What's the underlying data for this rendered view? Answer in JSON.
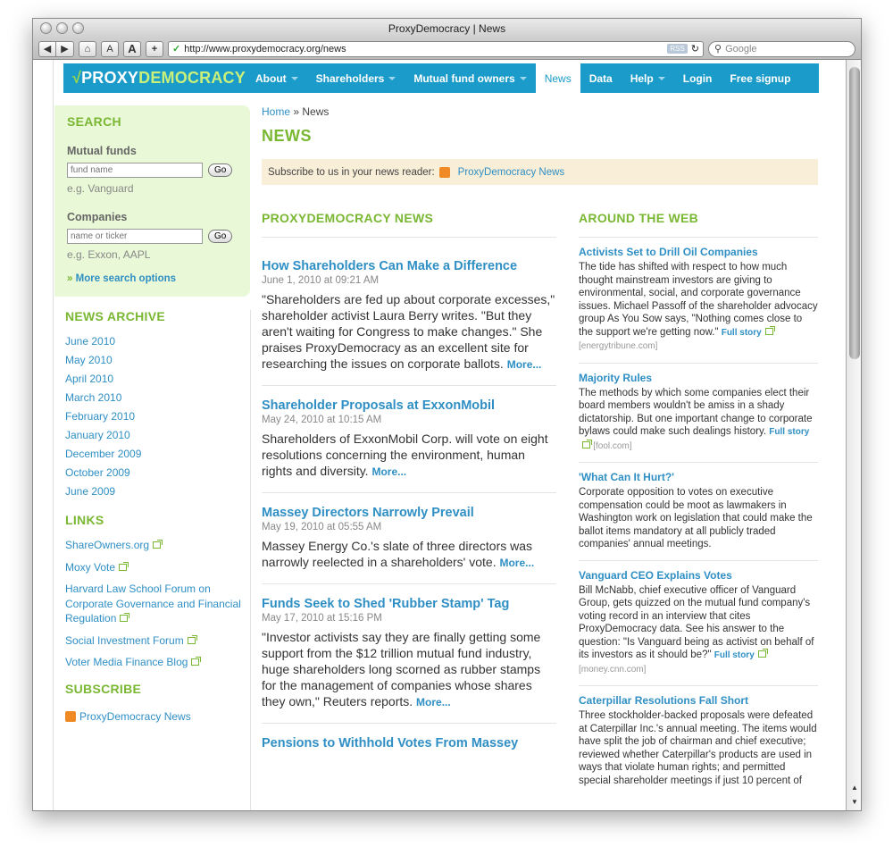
{
  "window": {
    "title": "ProxyDemocracy | News"
  },
  "toolbar": {
    "font_smaller": "A",
    "font_larger": "A",
    "add": "+",
    "url": "http://www.proxydemocracy.org/news",
    "rss": "RSS",
    "search_placeholder": "Google"
  },
  "header": {
    "logo_check": "√",
    "logo_proxy": "PROXY",
    "logo_democracy": "DEMOCRACY",
    "nav": [
      {
        "label": "About",
        "dropdown": true
      },
      {
        "label": "Shareholders",
        "dropdown": true
      },
      {
        "label": "Mutual fund owners",
        "dropdown": true
      },
      {
        "label": "News",
        "active": true
      },
      {
        "label": "Data"
      },
      {
        "label": "Help",
        "dropdown": true
      },
      {
        "label": "Login"
      },
      {
        "label": "Free signup"
      }
    ]
  },
  "search": {
    "heading": "SEARCH",
    "funds_label": "Mutual funds",
    "funds_placeholder": "fund name",
    "funds_go": "Go",
    "funds_eg": "e.g. Vanguard",
    "companies_label": "Companies",
    "companies_placeholder": "name or ticker",
    "companies_go": "Go",
    "companies_eg": "e.g. Exxon, AAPL",
    "more_options": "More search options"
  },
  "archive": {
    "heading": "NEWS ARCHIVE",
    "items": [
      "June 2010",
      "May 2010",
      "April 2010",
      "March 2010",
      "February 2010",
      "January 2010",
      "December 2009",
      "October 2009",
      "June 2009"
    ]
  },
  "links": {
    "heading": "LINKS",
    "items": [
      "ShareOwners.org",
      "Moxy Vote",
      "Harvard Law School Forum on Corporate Governance and Financial Regulation",
      "Social Investment Forum",
      "Voter Media Finance Blog"
    ]
  },
  "subscribe_side": {
    "heading": "SUBSCRIBE",
    "feed": "ProxyDemocracy News"
  },
  "main": {
    "breadcrumb_home": "Home",
    "breadcrumb_sep": "»",
    "breadcrumb_current": "News",
    "title": "NEWS",
    "subscribe_text": "Subscribe to us in your news reader:",
    "subscribe_link": "ProxyDemocracy News"
  },
  "pd_news": {
    "heading": "PROXYDEMOCRACY NEWS",
    "more": "More...",
    "stories": [
      {
        "title": "How Shareholders Can Make a Difference",
        "date": "June 1, 2010 at 09:21 AM",
        "body": "\"Shareholders are fed up about corporate excesses,\" shareholder activist Laura Berry writes. \"But they aren't waiting for Congress to make changes.\" She praises ProxyDemocracy as an excellent site for researching the issues on corporate ballots."
      },
      {
        "title": "Shareholder Proposals at ExxonMobil",
        "date": "May 24, 2010 at 10:15 AM",
        "body": "Shareholders of ExxonMobil Corp. will vote on eight resolutions concerning the environment, human rights and diversity."
      },
      {
        "title": "Massey Directors Narrowly Prevail",
        "date": "May 19, 2010 at 05:55 AM",
        "body": "Massey Energy Co.'s slate of three directors was narrowly reelected in a shareholders' vote."
      },
      {
        "title": "Funds Seek to Shed 'Rubber Stamp' Tag",
        "date": "May 17, 2010 at 15:16 PM",
        "body": "\"Investor activists say they are finally getting some support from the $12 trillion mutual fund industry, huge shareholders long scorned as rubber stamps for the management of companies whose shares they own,\" Reuters reports."
      },
      {
        "title": "Pensions to Withhold Votes From Massey",
        "date": "",
        "body": ""
      }
    ]
  },
  "web": {
    "heading": "AROUND THE WEB",
    "full_story": "Full story",
    "items": [
      {
        "title": "Activists Set to Drill Oil Companies",
        "body": "The tide has shifted with respect to how much thought mainstream investors are giving to environmental, social, and corporate governance issues. Michael Passoff of the shareholder advocacy group As You Sow says, \"Nothing comes close to the support we're getting now.\"",
        "source": "[energytribune.com]"
      },
      {
        "title": "Majority Rules",
        "body": "The methods by which some companies elect their board members wouldn't be amiss in a shady dictatorship. But one important change to corporate bylaws could make such dealings history.",
        "source": "[fool.com]"
      },
      {
        "title": "'What Can It Hurt?'",
        "body": "Corporate opposition to votes on executive compensation could be moot as lawmakers in Washington work on legislation that could make the ballot items mandatory at all publicly traded companies' annual meetings.",
        "source": ""
      },
      {
        "title": "Vanguard CEO Explains Votes",
        "body": "Bill McNabb, chief executive officer of Vanguard Group, gets quizzed on the mutual fund company's voting record in an interview that cites ProxyDemocracy data. See his answer to the question: \"Is Vanguard being as activist on behalf of its investors as it should be?\"",
        "source": "[money.cnn.com]"
      },
      {
        "title": "Caterpillar Resolutions Fall Short",
        "body": "Three stockholder-backed proposals were defeated at Caterpillar Inc.'s annual meeting. The items would have split the job of chairman and chief executive; reviewed whether Caterpillar's products are used in ways that violate human rights; and permitted special shareholder meetings if just 10 percent of",
        "source": ""
      }
    ]
  },
  "colors": {
    "brand_blue": "#1a9bc9",
    "brand_green": "#7ab733",
    "link": "#2f8fc4"
  }
}
